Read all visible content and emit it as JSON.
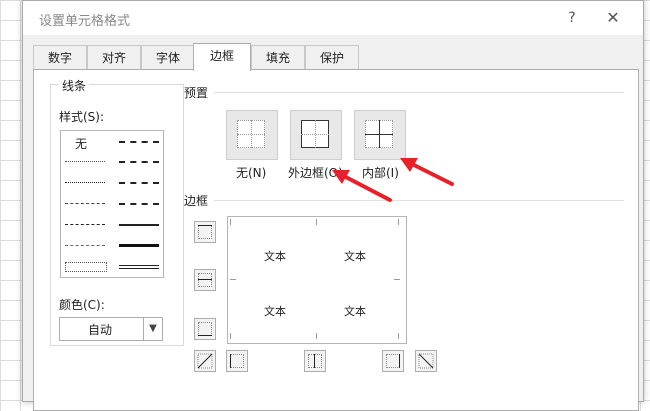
{
  "dialog": {
    "title": "设置单元格格式",
    "help": "?",
    "close": "✕"
  },
  "tabs": [
    "数字",
    "对齐",
    "字体",
    "边框",
    "填充",
    "保护"
  ],
  "active_tab": "边框",
  "line_section": {
    "legend": "线条",
    "style_label": "样式(S):",
    "none_label": "无",
    "color_label": "颜色(C):",
    "color_value": "自动"
  },
  "preset_section": {
    "label": "预置",
    "none": "无(N)",
    "outline": "外边框(O)",
    "inside": "内部(I)"
  },
  "border_section": {
    "label": "边框",
    "preview_text": [
      "文本",
      "文本",
      "文本",
      "文本"
    ]
  },
  "colors": {
    "arrow": "#e8202a",
    "active_tab_bg": "#ffffff"
  },
  "icons": {
    "help": "question-icon",
    "close": "close-icon",
    "dropdown": "chevron-down-icon"
  }
}
